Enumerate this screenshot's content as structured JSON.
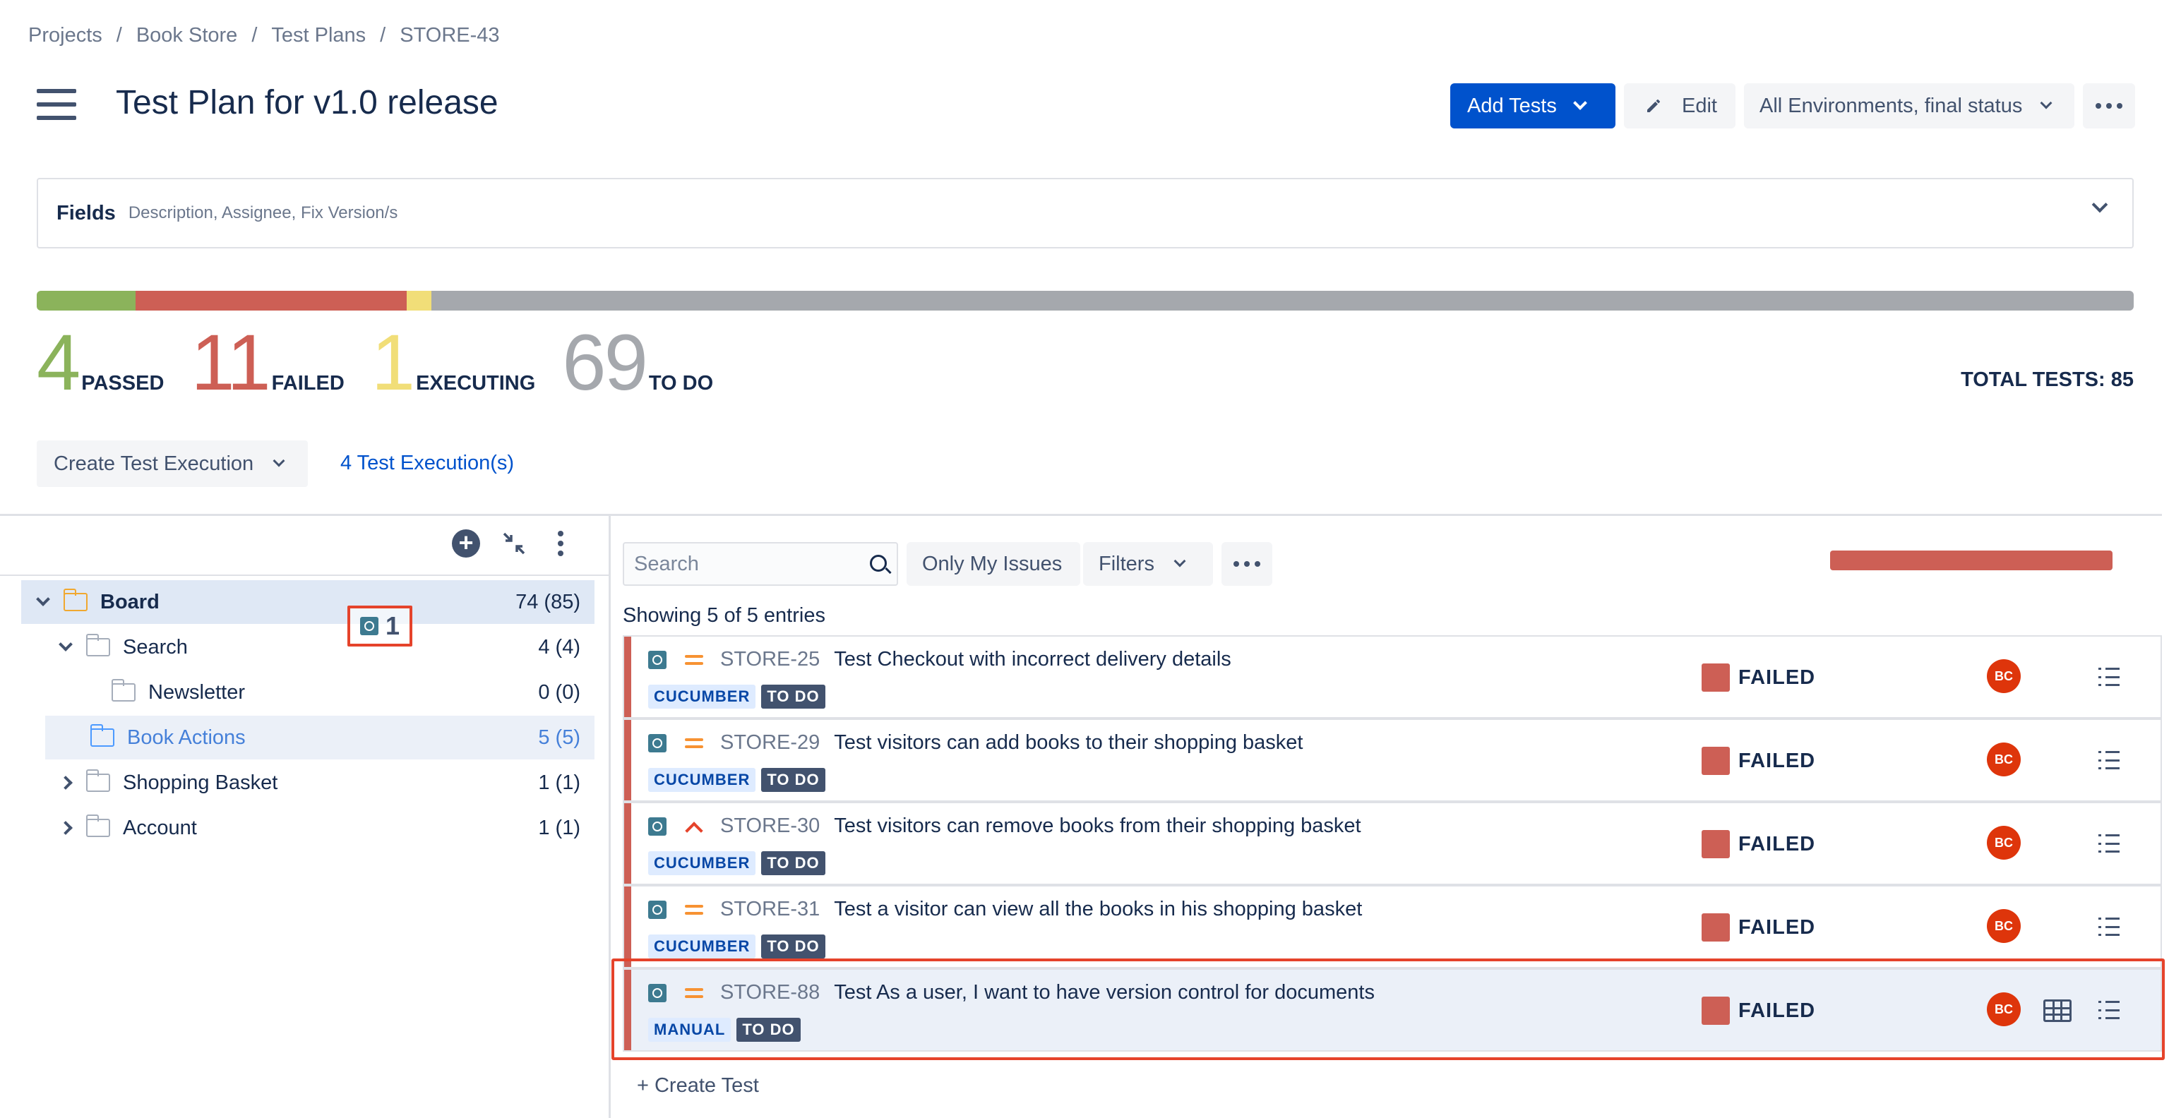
{
  "breadcrumb": [
    "Projects",
    "Book Store",
    "Test Plans",
    "STORE-43"
  ],
  "breadcrumb_sep": "/",
  "header": {
    "title": "Test Plan for v1.0 release",
    "add_tests": "Add Tests",
    "edit": "Edit",
    "environment": "All Environments, final status"
  },
  "fields": {
    "label": "Fields",
    "description": "Description, Assignee, Fix Version/s"
  },
  "progress": [
    {
      "status": "passed",
      "count": 4,
      "color": "#8bb35b"
    },
    {
      "status": "failed",
      "count": 11,
      "color": "#cd5f55"
    },
    {
      "status": "executing",
      "count": 1,
      "color": "#f1de78"
    },
    {
      "status": "todo",
      "count": 69,
      "color": "#a5a8ad"
    }
  ],
  "stats": [
    {
      "num": "4",
      "label": "PASSED",
      "color": "#8bb35b"
    },
    {
      "num": "11",
      "label": "FAILED",
      "color": "#cd5f55"
    },
    {
      "num": "1",
      "label": "EXECUTING",
      "color": "#f1de78"
    },
    {
      "num": "69",
      "label": "TO DO",
      "color": "#a5a8ad"
    }
  ],
  "total_tests": "TOTAL TESTS: 85",
  "create_execution": "Create Test Execution",
  "executions_link": "4 Test Execution(s)",
  "tree": {
    "plus": "+",
    "collapse": "↘↖",
    "drag_count": "1",
    "rows": [
      {
        "name": "Board",
        "count": "74 (85)"
      },
      {
        "name": "Search",
        "count": "4 (4)"
      },
      {
        "name": "Newsletter",
        "count": "0 (0)"
      },
      {
        "name": "Book Actions",
        "count": "5 (5)"
      },
      {
        "name": "Shopping Basket",
        "count": "1 (1)"
      },
      {
        "name": "Account",
        "count": "1 (1)"
      }
    ]
  },
  "list": {
    "search_placeholder": "Search",
    "only_my_issues": "Only My Issues",
    "filters": "Filters",
    "showing": "Showing 5 of 5 entries",
    "create_test": "+ Create Test",
    "tests": [
      {
        "key": "STORE-25",
        "summary": "Test Checkout with incorrect delivery details",
        "type": "CUCUMBER",
        "status_tag": "TO DO",
        "result": "FAILED",
        "assignee": "BC",
        "priority": "medium"
      },
      {
        "key": "STORE-29",
        "summary": "Test visitors can add books to their shopping basket",
        "type": "CUCUMBER",
        "status_tag": "TO DO",
        "result": "FAILED",
        "assignee": "BC",
        "priority": "medium"
      },
      {
        "key": "STORE-30",
        "summary": "Test visitors can remove books from their shopping basket",
        "type": "CUCUMBER",
        "status_tag": "TO DO",
        "result": "FAILED",
        "assignee": "BC",
        "priority": "high"
      },
      {
        "key": "STORE-31",
        "summary": "Test a visitor can view all the books in his shopping basket",
        "type": "CUCUMBER",
        "status_tag": "TO DO",
        "result": "FAILED",
        "assignee": "BC",
        "priority": "medium"
      },
      {
        "key": "STORE-88",
        "summary": "Test As a user, I want to have version control for documents",
        "type": "MANUAL",
        "status_tag": "TO DO",
        "result": "FAILED",
        "assignee": "BC",
        "priority": "medium"
      }
    ]
  }
}
